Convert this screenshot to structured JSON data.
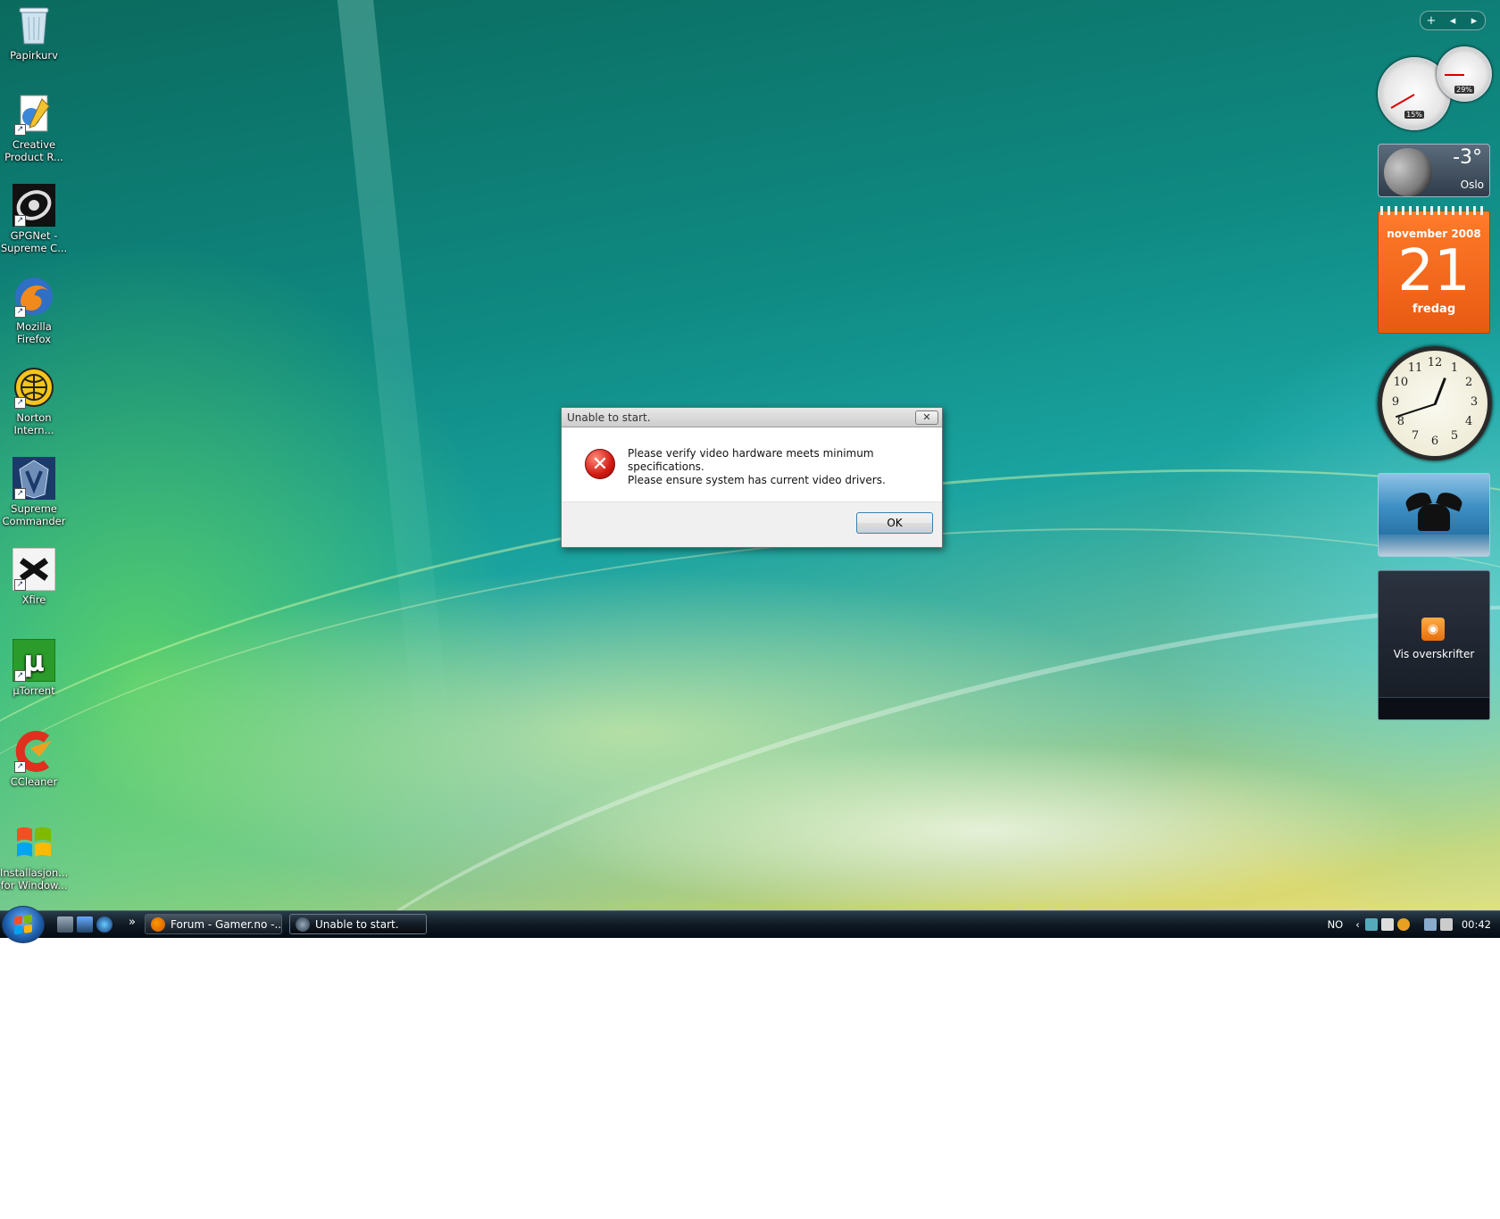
{
  "desktop": {
    "icons": [
      {
        "label": "Papirkurv",
        "icon": "recycle-bin-icon"
      },
      {
        "label": "Creative Product R...",
        "icon": "creative-product-registration-icon"
      },
      {
        "label": "GPGNet - Supreme C...",
        "icon": "gpgnet-icon"
      },
      {
        "label": "Mozilla Firefox",
        "icon": "firefox-icon"
      },
      {
        "label": "Norton Intern...",
        "icon": "norton-icon"
      },
      {
        "label": "Supreme Commander",
        "icon": "supreme-commander-icon"
      },
      {
        "label": "Xfire",
        "icon": "xfire-icon"
      },
      {
        "label": "µTorrent",
        "icon": "utorrent-icon"
      },
      {
        "label": "CCleaner",
        "icon": "ccleaner-icon"
      },
      {
        "label": "Installasjon... for Window...",
        "icon": "windows-install-icon"
      }
    ]
  },
  "dialog": {
    "title": "Unable to start.",
    "close_symbol": "✕",
    "message_line1": "Please verify video hardware meets minimum specifications.",
    "message_line2": "Please ensure system has current video drivers.",
    "icon_symbol": "✕",
    "ok_label": "OK"
  },
  "sidebar": {
    "controls": {
      "add": "+",
      "prev": "◂",
      "next": "▸"
    },
    "cpu_meter": {
      "cpu_percent": "15%",
      "memory_percent": "29%"
    },
    "weather": {
      "temperature": "-3°",
      "city": "Oslo"
    },
    "calendar": {
      "month_year": "november 2008",
      "day": "21",
      "weekday": "fredag"
    },
    "clock": {
      "hour": 0,
      "minute": 42,
      "numbers": [
        "12",
        "1",
        "2",
        "3",
        "4",
        "5",
        "6",
        "7",
        "8",
        "9",
        "10",
        "11"
      ]
    },
    "feeds": {
      "label": "Vis overskrifter",
      "rss_symbol": "◉"
    }
  },
  "taskbar": {
    "overflow_symbol": "»",
    "buttons": [
      {
        "label": "Forum - Gamer.no -..."
      },
      {
        "label": "Unable to start."
      }
    ],
    "tray": {
      "language": "NO",
      "expand_symbol": "‹",
      "time": "00:42"
    }
  },
  "colors": {
    "accent_orange": "#e85a12",
    "error_red": "#d21a12",
    "taskbar": "#0f1a24"
  }
}
